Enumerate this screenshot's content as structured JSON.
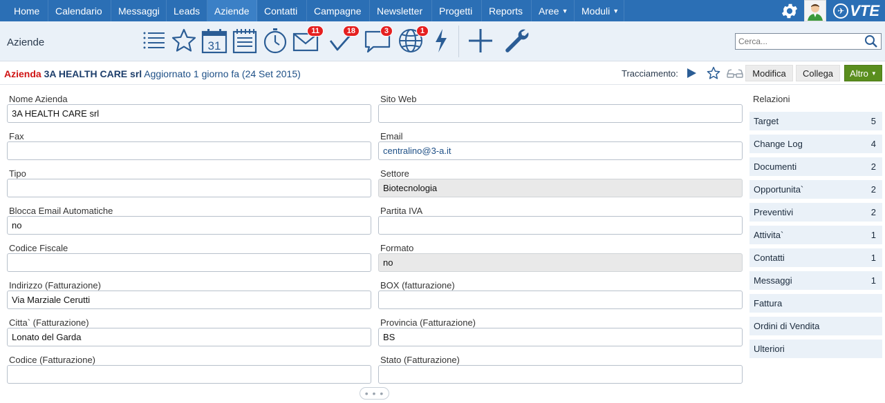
{
  "nav": {
    "items": [
      {
        "label": "Home"
      },
      {
        "label": "Calendario"
      },
      {
        "label": "Messaggi"
      },
      {
        "label": "Leads"
      },
      {
        "label": "Aziende"
      },
      {
        "label": "Contatti"
      },
      {
        "label": "Campagne"
      },
      {
        "label": "Newsletter"
      },
      {
        "label": "Progetti"
      },
      {
        "label": "Reports"
      },
      {
        "label": "Aree"
      },
      {
        "label": "Moduli"
      }
    ],
    "active_index": 4,
    "logo_text": "VTE"
  },
  "toolbar": {
    "module_title": "Aziende",
    "calendar_day": "31",
    "badges": {
      "email": "11",
      "tasks": "18",
      "chat": "3",
      "globe": "1"
    },
    "search_placeholder": "Cerca..."
  },
  "header": {
    "module": "Azienda",
    "record_name": "3A HEALTH CARE srl",
    "updated": "Aggiornato 1 giorno fa (24 Set 2015)",
    "tracking_label": "Tracciamento:",
    "modifica_label": "Modifica",
    "collega_label": "Collega",
    "altro_label": "Altro"
  },
  "form": {
    "left": [
      {
        "label": "Nome Azienda",
        "value": "3A HEALTH CARE srl",
        "readonly": false
      },
      {
        "label": "Fax",
        "value": "",
        "readonly": false
      },
      {
        "label": "Tipo",
        "value": "",
        "readonly": false
      },
      {
        "label": "Blocca Email Automatiche",
        "value": "no",
        "readonly": false
      },
      {
        "label": "Codice Fiscale",
        "value": "",
        "readonly": false
      },
      {
        "label": "Indirizzo (Fatturazione)",
        "value": "Via Marziale Cerutti",
        "readonly": false
      },
      {
        "label": "Citta` (Fatturazione)",
        "value": "Lonato del Garda",
        "readonly": false
      },
      {
        "label": "Codice (Fatturazione)",
        "value": "",
        "readonly": false
      }
    ],
    "right": [
      {
        "label": "Sito Web",
        "value": "",
        "readonly": false
      },
      {
        "label": "Email",
        "value": "centralino@3-a.it",
        "readonly": false
      },
      {
        "label": "Settore",
        "value": "Biotecnologia",
        "readonly": true
      },
      {
        "label": "Partita IVA",
        "value": "",
        "readonly": false
      },
      {
        "label": "Formato",
        "value": "no",
        "readonly": true
      },
      {
        "label": "BOX (fatturazione)",
        "value": "",
        "readonly": false
      },
      {
        "label": "Provincia (Fatturazione)",
        "value": "BS",
        "readonly": false
      },
      {
        "label": "Stato (Fatturazione)",
        "value": "",
        "readonly": false
      }
    ],
    "more_handle": "• • •"
  },
  "related": {
    "title": "Relazioni",
    "items": [
      {
        "label": "Target",
        "count": "5"
      },
      {
        "label": "Change Log",
        "count": "4"
      },
      {
        "label": "Documenti",
        "count": "2"
      },
      {
        "label": "Opportunita`",
        "count": "2"
      },
      {
        "label": "Preventivi",
        "count": "2"
      },
      {
        "label": "Attivita`",
        "count": "1"
      },
      {
        "label": "Contatti",
        "count": "1"
      },
      {
        "label": "Messaggi",
        "count": "1"
      },
      {
        "label": "Fattura",
        "count": ""
      },
      {
        "label": "Ordini di Vendita",
        "count": ""
      },
      {
        "label": "Ulteriori",
        "count": ""
      }
    ]
  }
}
